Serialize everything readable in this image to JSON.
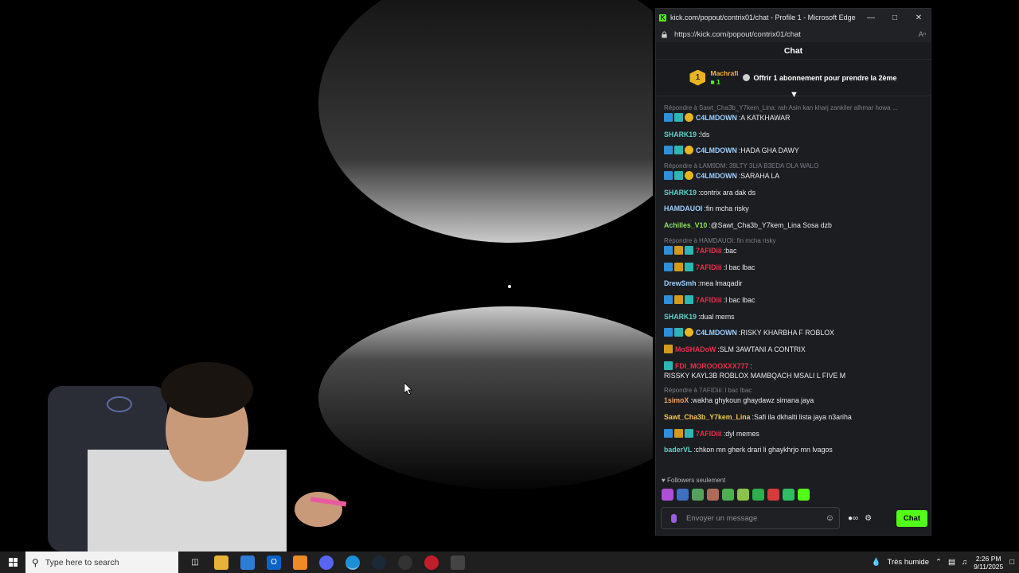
{
  "window": {
    "title": "kick.com/popout/contrix01/chat - Profile 1 - Microsoft Edge",
    "url": "https://kick.com/popout/contrix01/chat"
  },
  "chat": {
    "header": "Chat",
    "pinned": {
      "rank": "1",
      "username": "Machrafi",
      "count": "1",
      "gift_text": "Offrir 1 abonnement pour prendre la 2ème"
    },
    "messages": [
      {
        "reply": "Répondre à Sawt_Cha3b_Y7kem_Lina: rah Asin kan kharj zankiler alhmar howa ...",
        "badges": [
          "blue",
          "teal",
          "gold"
        ],
        "user": "C4LMDOWN",
        "color": "#9ed0ff",
        "text": "A KATKHAWAR"
      },
      {
        "badges": [],
        "user": "SHARK19",
        "color": "#5fd1c7",
        "text": "!ds"
      },
      {
        "badges": [
          "blue",
          "teal",
          "gold"
        ],
        "user": "C4LMDOWN",
        "color": "#9ed0ff",
        "text": "HADA GHA DAWY"
      },
      {
        "reply": "Répondre à LAM9DM: 39LTY 3LIA B3EDA OLA WALO",
        "badges": [
          "blue",
          "teal",
          "gold"
        ],
        "user": "C4LMDOWN",
        "color": "#9ed0ff",
        "text": "SARAHA LA"
      },
      {
        "badges": [],
        "user": "SHARK19",
        "color": "#5fd1c7",
        "text": "contrix ara dak ds"
      },
      {
        "badges": [],
        "user": "HAMDAUOI",
        "color": "#9ed0ff",
        "text": "fin mcha risky"
      },
      {
        "badges": [],
        "user": "Achilles_V10",
        "color": "#8fe35a",
        "text": "@Sawt_Cha3b_Y7kem_Lina Sosa dzb"
      },
      {
        "reply": "Répondre à HAMDAUOI: fin mcha risky",
        "badges": [
          "blue",
          "crown",
          "teal"
        ],
        "user": "7AFIDiii",
        "color": "#e8304a",
        "text": "bac"
      },
      {
        "badges": [
          "blue",
          "crown",
          "teal"
        ],
        "user": "7AFIDiii",
        "color": "#e8304a",
        "text": "l bac lbac"
      },
      {
        "badges": [],
        "user": "DrewSmh",
        "color": "#9ed0ff",
        "text": "mea lmaqadir"
      },
      {
        "badges": [
          "blue",
          "crown",
          "teal"
        ],
        "user": "7AFIDiii",
        "color": "#e8304a",
        "text": "l bac lbac"
      },
      {
        "badges": [],
        "user": "SHARK19",
        "color": "#5fd1c7",
        "text": "dual mems"
      },
      {
        "badges": [
          "blue",
          "teal",
          "gold"
        ],
        "user": "C4LMDOWN",
        "color": "#9ed0ff",
        "text": "RISKY KHARBHA F ROBLOX"
      },
      {
        "badges": [
          "crown"
        ],
        "user": "MoSHADoW",
        "color": "#e8304a",
        "text": "SLM 3AWTANI A CONTRIX"
      },
      {
        "badges": [
          "teal"
        ],
        "user": "FDI_MOROOOXXX777",
        "color": "#e8304a",
        "text": "RISSKY KAYL3B ROBLOX MAMBQACH MSALI L FIVE M"
      },
      {
        "reply": "Répondre à 7AFIDiii: l bac lbac",
        "badges": [],
        "user": "1simoX",
        "color": "#f5a25a",
        "text": "wakha ghykoun ghaydawz simana jaya"
      },
      {
        "badges": [],
        "user": "Sawt_Cha3b_Y7kem_Lina",
        "color": "#f2c94c",
        "text": "Safi ila dkhalti lista jaya n3ariha"
      },
      {
        "badges": [
          "blue",
          "crown",
          "teal"
        ],
        "user": "7AFIDiii",
        "color": "#e8304a",
        "text": "dyl memes"
      },
      {
        "badges": [],
        "user": "baderVL",
        "color": "#5fd1c7",
        "text": "chkon mn gherk drari li ghaykhrjo mn lvagos"
      }
    ],
    "followers_label": "Followers seulement",
    "input_placeholder": "Envoyer un message",
    "send_label": "Chat"
  },
  "taskbar": {
    "search_placeholder": "Type here to search",
    "weather": "Très humide",
    "time": "2:26 PM",
    "date": "9/11/2025"
  }
}
